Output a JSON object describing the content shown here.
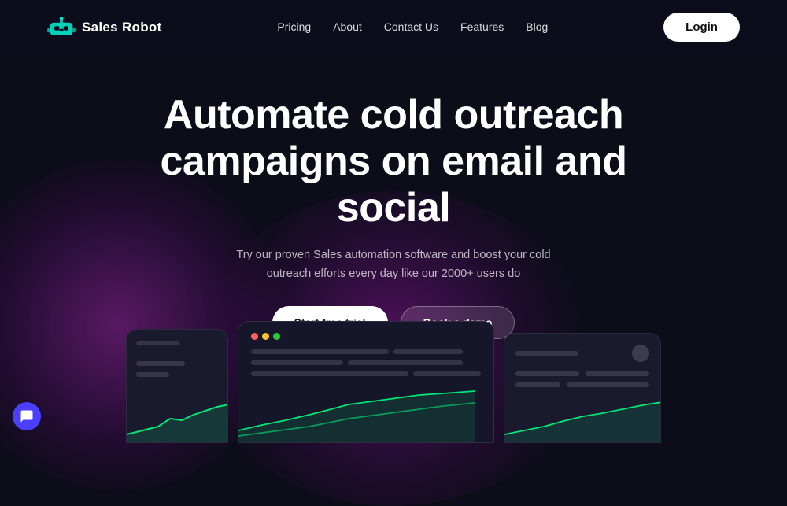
{
  "nav": {
    "logo_text": "Sales Robot",
    "links": [
      {
        "id": "pricing",
        "label": "Pricing"
      },
      {
        "id": "about",
        "label": "About"
      },
      {
        "id": "contact",
        "label": "Contact Us"
      },
      {
        "id": "features",
        "label": "Features"
      },
      {
        "id": "blog",
        "label": "Blog"
      }
    ],
    "login_label": "Login"
  },
  "hero": {
    "title": "Automate cold outreach campaigns on email and social",
    "subtitle": "Try our proven Sales automation software and boost your cold outreach efforts every day like our 2000+ users do",
    "cta_primary": "Start free trial",
    "cta_secondary": "Book a demo"
  },
  "colors": {
    "accent_green": "#00e676",
    "accent_purple": "#7b2fff",
    "bg_dark": "#0d0d1a",
    "nav_bg": "#0d0d1a"
  }
}
